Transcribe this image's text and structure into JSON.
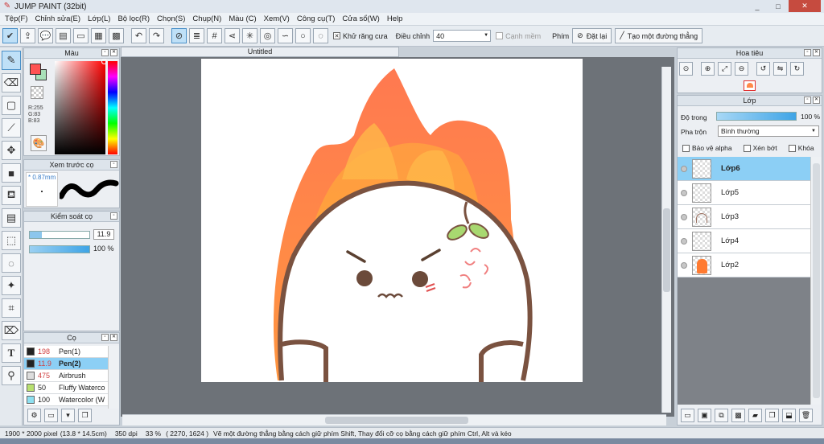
{
  "app": {
    "title": "JUMP PAINT (32bit)",
    "win_min": "_",
    "win_max": "□",
    "win_close": "✕"
  },
  "menu": [
    "Tệp(F)",
    "Chỉnh sửa(E)",
    "Lớp(L)",
    "Bộ lọc(R)",
    "Chọn(S)",
    "Chụp(N)",
    "Màu (C)",
    "Xem(V)",
    "Công cụ(T)",
    "Cửa sổ(W)",
    "Help"
  ],
  "toolbar": {
    "antialias_label": "Khử răng cưa",
    "adjust_label": "Điều chỉnh",
    "adjust_value": "40",
    "smooth_label": "Cạnh mềm",
    "keys_label": "Phím",
    "reset_label": "Đặt lại",
    "line_label": "Tạo một đường thẳng"
  },
  "color_panel": {
    "title": "Màu",
    "r": "R:255",
    "g": "G:83",
    "b": "B:83",
    "primary": "#ff5353",
    "secondary": "#a8e0b8"
  },
  "preview_panel": {
    "title": "Xem trước cọ",
    "size": "* 0.87mm"
  },
  "control_panel": {
    "title": "Kiểm soát cọ",
    "size_value": "11.9",
    "opacity_value": "100 %"
  },
  "brush_panel": {
    "title": "Cọ",
    "brushes": [
      {
        "size": "198",
        "name": "Pen(1)",
        "color": "#222222",
        "size_color": "#d04040"
      },
      {
        "size": "11.9",
        "name": "Pen(2)",
        "color": "#222222",
        "size_color": "#d04040"
      },
      {
        "size": "475",
        "name": "Airbrush",
        "color": "#dddddd",
        "size_color": "#d04040"
      },
      {
        "size": "50",
        "name": "Fluffy Waterco",
        "color": "#b8e070",
        "size_color": "#222222"
      },
      {
        "size": "100",
        "name": "Watercolor (W",
        "color": "#8ee0f0",
        "size_color": "#222222"
      }
    ]
  },
  "document": {
    "tab_title": "Untitled"
  },
  "navigator_panel": {
    "title": "Hoa tiêu"
  },
  "layer_panel": {
    "title": "Lớp",
    "opacity_label": "Độ trong",
    "opacity_value": "100 %",
    "blend_label": "Pha trộn",
    "blend_value": "Bình thường",
    "protect_alpha": "Bảo vệ alpha",
    "clip": "Xén bớt",
    "lock": "Khóa",
    "layers": [
      {
        "name": "Lớp6",
        "selected": true
      },
      {
        "name": "Lớp5",
        "selected": false
      },
      {
        "name": "Lớp3",
        "selected": false
      },
      {
        "name": "Lớp4",
        "selected": false
      },
      {
        "name": "Lớp2",
        "selected": false
      }
    ]
  },
  "status": {
    "size": "1900 * 2000 pixel",
    "cm": "(13.8 * 14.5cm)",
    "dpi": "350 dpi",
    "zoom": "33 %",
    "coords": "( 2270, 1624 )",
    "hint": "Vẽ một đường thẳng bằng cách giữ phím Shift, Thay đổi cỡ cọ bằng cách giữ phím Ctrl, Alt và kéo"
  }
}
